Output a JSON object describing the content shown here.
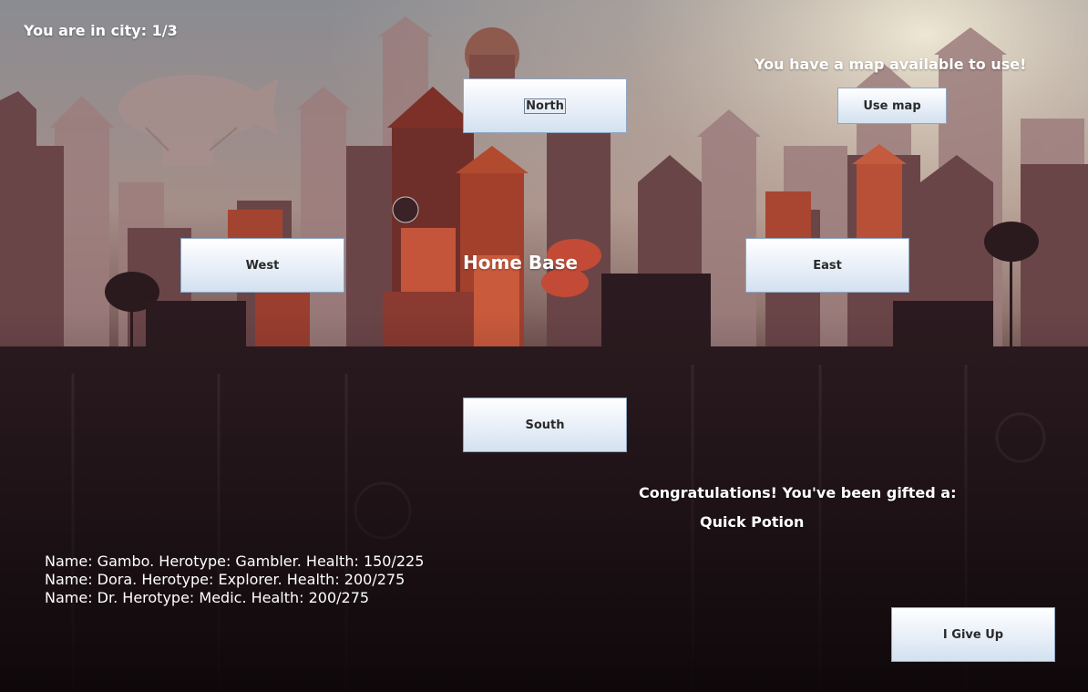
{
  "status": {
    "city_text": "You are in city: 1/3"
  },
  "map": {
    "notice": "You have a map available to use!",
    "button_label": "Use map"
  },
  "location": {
    "name": "Home Base"
  },
  "navigation": {
    "north": "North",
    "south": "South",
    "east": "East",
    "west": "West"
  },
  "gift": {
    "message": "Congratulations! You've been gifted a:",
    "item": "Quick Potion"
  },
  "party": [
    "Name: Gambo. Herotype: Gambler. Health: 150/225",
    "Name: Dora. Herotype: Explorer. Health: 200/275",
    "Name: Dr. Herotype: Medic. Health: 200/275"
  ],
  "actions": {
    "give_up": "I Give Up"
  },
  "colors": {
    "button_top": "#ffffff",
    "button_bottom": "#d3e1f0",
    "button_border": "#8fa6c2",
    "text": "#ffffff"
  }
}
